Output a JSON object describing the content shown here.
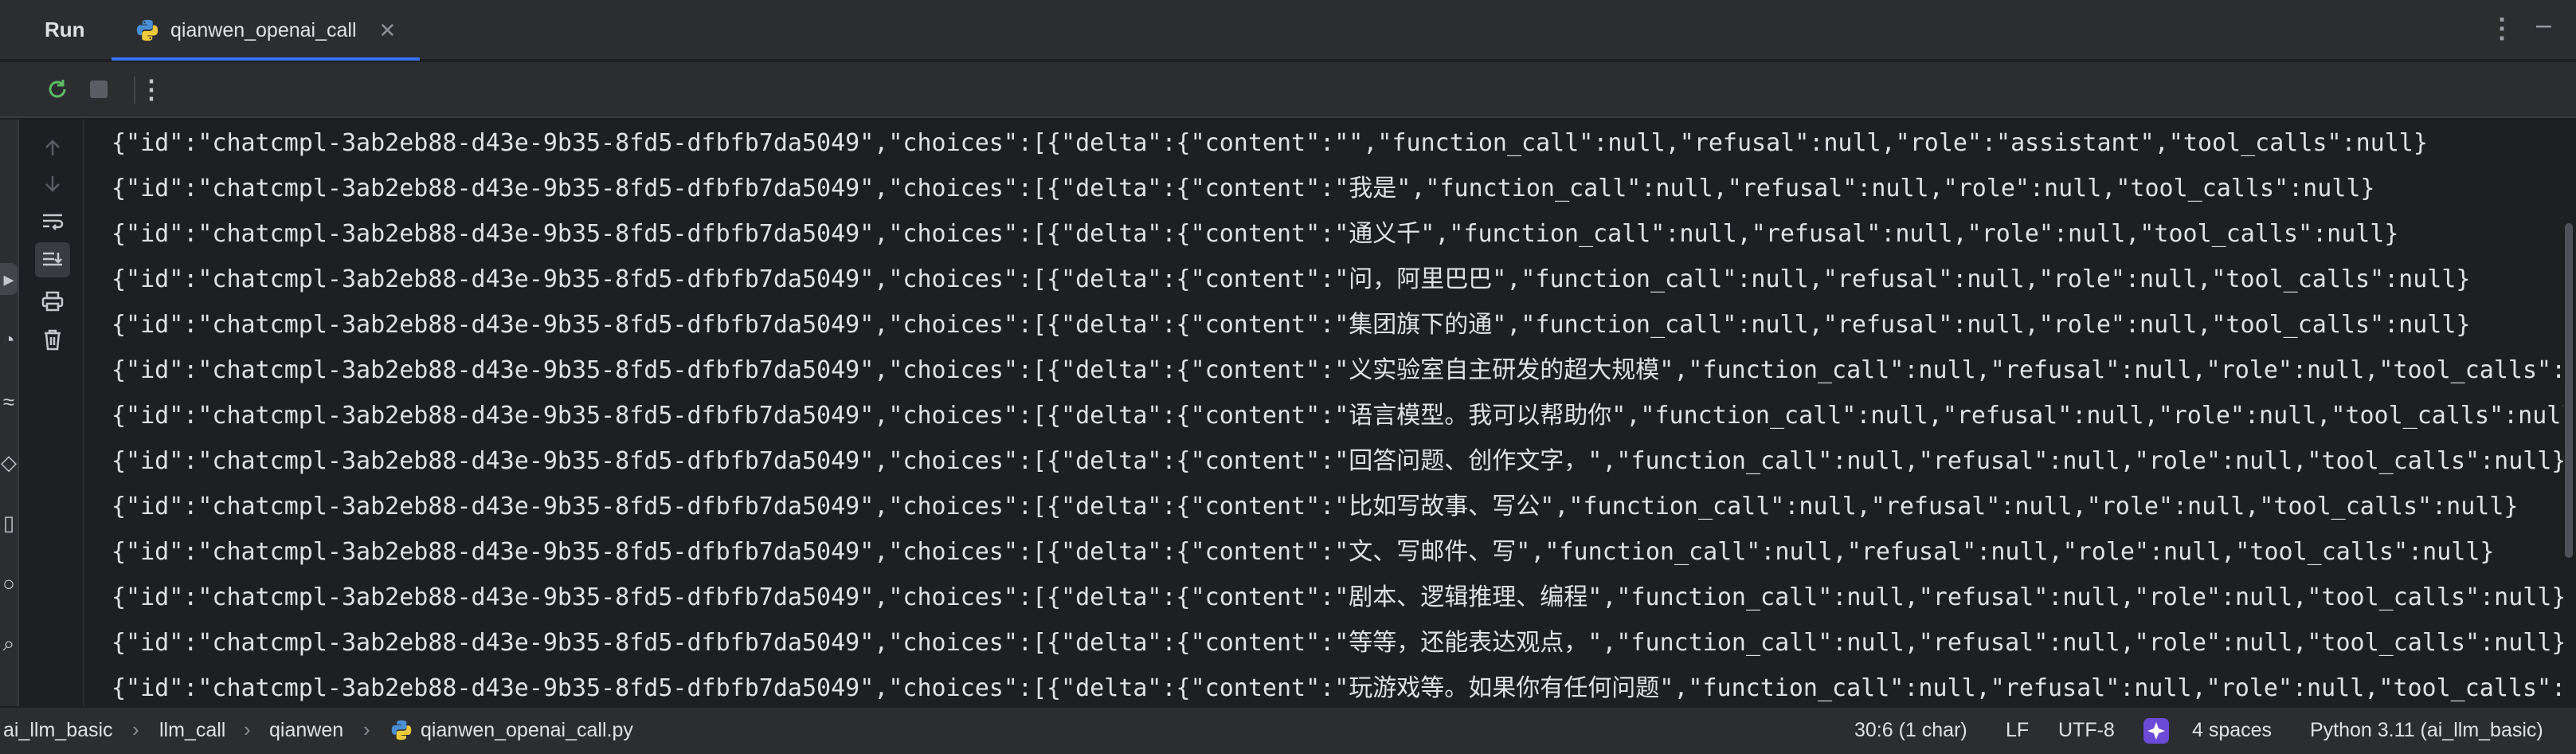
{
  "header": {
    "tool_window_title": "Run",
    "tab_label": "qianwen_openai_call",
    "tab_close_icon": "close-icon",
    "more_icon": "more-vertical-icon",
    "minimize_icon": "minimize-icon"
  },
  "toolbar": {
    "icons": [
      "rerun-icon",
      "stop-icon",
      "more-vertical-icon"
    ]
  },
  "gutter": {
    "icons": [
      "arrow-up-icon",
      "arrow-down-icon",
      "soft-wrap-icon",
      "scroll-to-end-icon",
      "print-icon",
      "trash-icon"
    ]
  },
  "console": {
    "lines": [
      "{\"id\":\"chatcmpl-3ab2eb88-d43e-9b35-8fd5-dfbfb7da5049\",\"choices\":[{\"delta\":{\"content\":\"\",\"function_call\":null,\"refusal\":null,\"role\":\"assistant\",\"tool_calls\":null}",
      "{\"id\":\"chatcmpl-3ab2eb88-d43e-9b35-8fd5-dfbfb7da5049\",\"choices\":[{\"delta\":{\"content\":\"我是\",\"function_call\":null,\"refusal\":null,\"role\":null,\"tool_calls\":null}",
      "{\"id\":\"chatcmpl-3ab2eb88-d43e-9b35-8fd5-dfbfb7da5049\",\"choices\":[{\"delta\":{\"content\":\"通义千\",\"function_call\":null,\"refusal\":null,\"role\":null,\"tool_calls\":null}",
      "{\"id\":\"chatcmpl-3ab2eb88-d43e-9b35-8fd5-dfbfb7da5049\",\"choices\":[{\"delta\":{\"content\":\"问，阿里巴巴\",\"function_call\":null,\"refusal\":null,\"role\":null,\"tool_calls\":null}",
      "{\"id\":\"chatcmpl-3ab2eb88-d43e-9b35-8fd5-dfbfb7da5049\",\"choices\":[{\"delta\":{\"content\":\"集团旗下的通\",\"function_call\":null,\"refusal\":null,\"role\":null,\"tool_calls\":null}",
      "{\"id\":\"chatcmpl-3ab2eb88-d43e-9b35-8fd5-dfbfb7da5049\",\"choices\":[{\"delta\":{\"content\":\"义实验室自主研发的超大规模\",\"function_call\":null,\"refusal\":null,\"role\":null,\"tool_calls\":null}",
      "{\"id\":\"chatcmpl-3ab2eb88-d43e-9b35-8fd5-dfbfb7da5049\",\"choices\":[{\"delta\":{\"content\":\"语言模型。我可以帮助你\",\"function_call\":null,\"refusal\":null,\"role\":null,\"tool_calls\":null}",
      "{\"id\":\"chatcmpl-3ab2eb88-d43e-9b35-8fd5-dfbfb7da5049\",\"choices\":[{\"delta\":{\"content\":\"回答问题、创作文字，\",\"function_call\":null,\"refusal\":null,\"role\":null,\"tool_calls\":null}",
      "{\"id\":\"chatcmpl-3ab2eb88-d43e-9b35-8fd5-dfbfb7da5049\",\"choices\":[{\"delta\":{\"content\":\"比如写故事、写公\",\"function_call\":null,\"refusal\":null,\"role\":null,\"tool_calls\":null}",
      "{\"id\":\"chatcmpl-3ab2eb88-d43e-9b35-8fd5-dfbfb7da5049\",\"choices\":[{\"delta\":{\"content\":\"文、写邮件、写\",\"function_call\":null,\"refusal\":null,\"role\":null,\"tool_calls\":null}",
      "{\"id\":\"chatcmpl-3ab2eb88-d43e-9b35-8fd5-dfbfb7da5049\",\"choices\":[{\"delta\":{\"content\":\"剧本、逻辑推理、编程\",\"function_call\":null,\"refusal\":null,\"role\":null,\"tool_calls\":null}",
      "{\"id\":\"chatcmpl-3ab2eb88-d43e-9b35-8fd5-dfbfb7da5049\",\"choices\":[{\"delta\":{\"content\":\"等等，还能表达观点，\",\"function_call\":null,\"refusal\":null,\"role\":null,\"tool_calls\":null}",
      "{\"id\":\"chatcmpl-3ab2eb88-d43e-9b35-8fd5-dfbfb7da5049\",\"choices\":[{\"delta\":{\"content\":\"玩游戏等。如果你有任何问题\",\"function_call\":null,\"refusal\":null,\"role\":null,\"tool_calls\":null}"
    ]
  },
  "statusbar": {
    "breadcrumb": [
      "ai_llm_basic",
      "llm_call",
      "qianwen",
      "qianwen_openai_call.py"
    ],
    "position": "30:6 (1 char)",
    "line_separator": "LF",
    "encoding": "UTF-8",
    "indent": "4 spaces",
    "interpreter": "Python 3.11 (ai_llm_basic)"
  },
  "colors": {
    "background": "#1e1f22",
    "panel": "#2b2d30",
    "accent": "#3574f0",
    "text": "#dfe1e5",
    "muted": "#8c8f94"
  }
}
